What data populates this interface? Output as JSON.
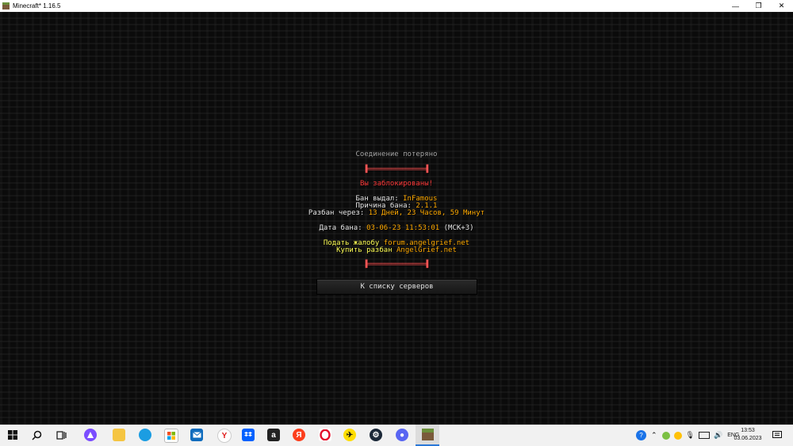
{
  "window": {
    "title": "Minecraft* 1.16.5",
    "minimize": "—",
    "maximize": "❐",
    "close": "✕"
  },
  "screen": {
    "title": "Соединение потеряно",
    "top_bar": "▐=================▌",
    "banned": "Вы заблокированы!",
    "issued_label": "Бан выдал: ",
    "issued_value": "InFamous",
    "reason_label": "Причина бана: ",
    "reason_value": "2.1.1",
    "unban_label": "Разбан через: ",
    "unban_value": "13 Дней, 23 Часов, 59 Минут",
    "date_label": "Дата бана: ",
    "date_value": "03-06-23 11:53:01",
    "date_tz": " (МСК+3)",
    "appeal_label": "Подать жалобу ",
    "appeal_value": "forum.angelgrief.net",
    "buy_label": "Купить разбан ",
    "buy_value": "AngelGrief.net",
    "bottom_bar": "▐=================▌",
    "button": "К списку серверов"
  },
  "taskbar": {
    "icons": [
      "windows-start",
      "search",
      "task-view",
      "alice",
      "file-explorer",
      "edge",
      "store",
      "mail",
      "yandex-browser",
      "dropbox",
      "amazon",
      "yandex",
      "opera",
      "yandex-disk",
      "steam",
      "discord-like",
      "minecraft"
    ],
    "lang": "ENG",
    "time": "13:53",
    "date": "03.06.2023",
    "colors": {
      "accent": "#ffaa00",
      "red": "#ff3b3b",
      "yellow": "#ffff55"
    }
  }
}
